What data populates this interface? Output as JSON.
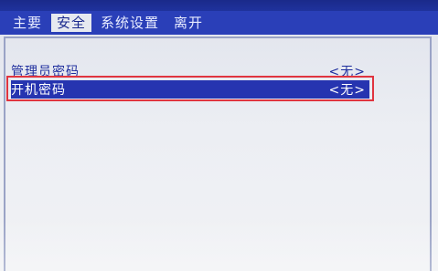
{
  "menu": {
    "tabs": [
      {
        "label": "主要"
      },
      {
        "label": "安全"
      },
      {
        "label": "系统设置"
      },
      {
        "label": "离开"
      }
    ],
    "active_index": 1
  },
  "security": {
    "items": [
      {
        "label": "管理员密码",
        "value": "<无>"
      },
      {
        "label": "开机密码",
        "value": "<无>"
      }
    ]
  },
  "colors": {
    "menu_bar": "#2a3fb8",
    "active_tab_bg": "#e6e9f0",
    "text_blue": "#1f2e9e",
    "selected_row_bg": "#2634b0",
    "highlight_border": "#e0343f"
  }
}
